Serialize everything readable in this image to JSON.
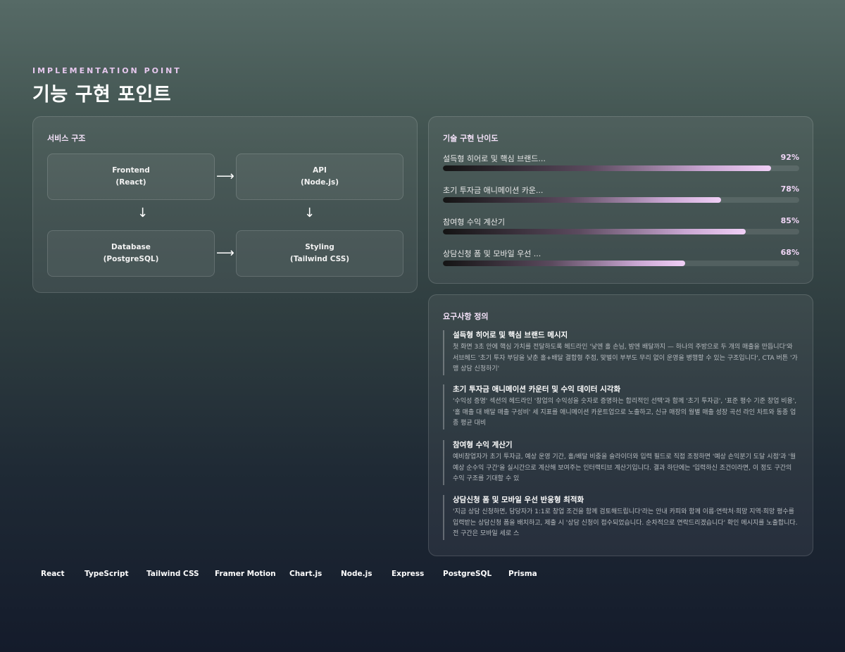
{
  "header": {
    "eyebrow": "IMPLEMENTATION POINT",
    "title": "기능 구현 포인트"
  },
  "architecture": {
    "title": "서비스 구조",
    "nodes": [
      {
        "name": "Frontend",
        "tech": "(React)"
      },
      {
        "name": "API",
        "tech": "(Node.js)"
      },
      {
        "name": "Database",
        "tech": "(PostgreSQL)"
      },
      {
        "name": "Styling",
        "tech": "(Tailwind CSS)"
      }
    ],
    "arrows": {
      "right": "⟶",
      "down": "↓"
    }
  },
  "difficulty": {
    "title": "기술 구현 난이도",
    "items": [
      {
        "label": "설득형 히어로 및 핵심 브랜드...",
        "value": "92%",
        "level": 92
      },
      {
        "label": "초기 투자금 애니메이션 카운...",
        "value": "78%",
        "level": 78
      },
      {
        "label": "참여형 수익 계산기",
        "value": "85%",
        "level": 85
      },
      {
        "label": "상담신청 폼 및 모바일 우선 ...",
        "value": "68%",
        "level": 68
      }
    ]
  },
  "requirements": {
    "title": "요구사항 정의",
    "items": [
      {
        "title": "설득형 히어로 및 핵심 브랜드 메시지",
        "body": "첫 화면 3초 안에 핵심 가치를 전달하도록 헤드라인 '낮엔 홀 손님, 밤엔 배달까지 — 하나의 주방으로 두 개의 매출을 만듭니다'와 서브헤드 '초기 투자 부담을 낮춘 홀+배달 결합형 주점, 맞벌이 부부도 무리 없이 운영을 병행할 수 있는 구조입니다', CTA 버튼 '가맹 상담 신청하기'"
      },
      {
        "title": "초기 투자금 애니메이션 카운터 및 수익 데이터 시각화",
        "body": "'수익성 증명' 섹션의 헤드라인 '창업의 수익성을 숫자로 증명하는 합리적인 선택'과 함께 '초기 투자금', '표준 평수 기준 창업 비용', '홀 매출 대 배달 매출 구성비' 세 지표를 애니메이션 카운트업으로 노출하고, 신규 매장의 월별 매출 성장 곡선 라인 차트와 동종 업종 평균 대비"
      },
      {
        "title": "참여형 수익 계산기",
        "body": "예비창업자가 초기 투자금, 예상 운영 기간, 홀/배달 비중을 슬라이더와 입력 필드로 직접 조정하면 '예상 손익분기 도달 시점'과 '월 예상 순수익 구간'을 실시간으로 계산해 보여주는 인터랙티브 계산기입니다. 결과 하단에는 '입력하신 조건이라면, 이 정도 구간의 수익 구조를 기대할 수 있"
      },
      {
        "title": "상담신청 폼 및 모바일 우선 반응형 최적화",
        "body": "'지금 상담 신청하면, 담당자가 1:1로 창업 조건을 함께 검토해드립니다'라는 안내 카피와 함께 이름·연락처·희망 지역·희망 평수를 입력받는 상담신청 폼을 배치하고, 제출 시 '상담 신청이 접수되었습니다. 순차적으로 연락드리겠습니다' 확인 메시지를 노출합니다. 전 구간은 모바일 세로 스"
      }
    ]
  },
  "tech_stack": [
    "React",
    "TypeScript",
    "Tailwind CSS",
    "Framer Motion",
    "Chart.js",
    "Node.js",
    "Express",
    "PostgreSQL",
    "Prisma"
  ]
}
